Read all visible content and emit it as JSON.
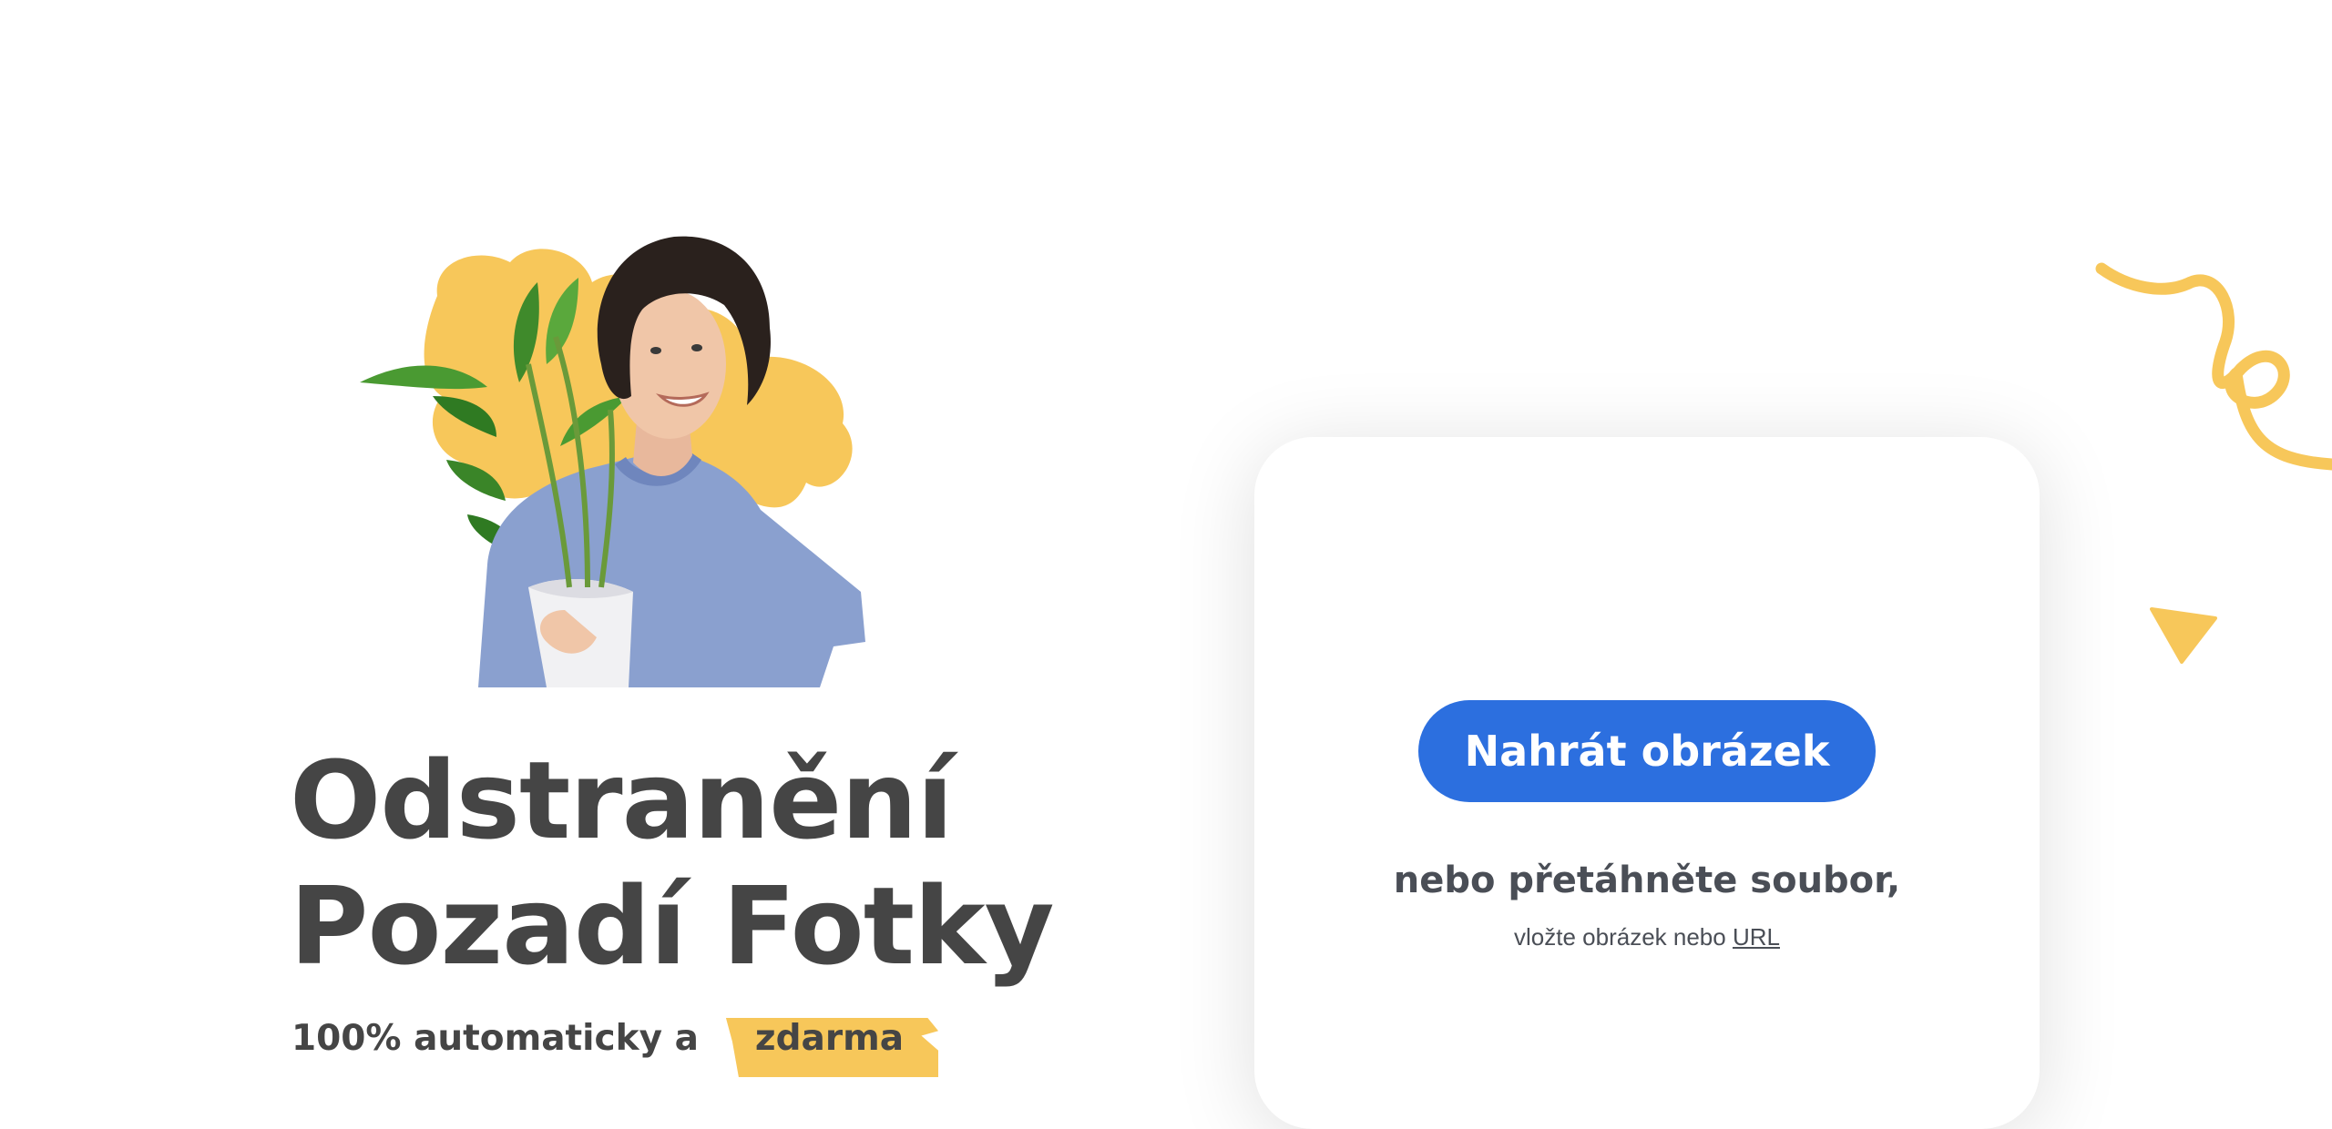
{
  "hero": {
    "title_line1": "Odstranění",
    "title_line2": "Pozadí Fotky",
    "subtitle_prefix": "100% automaticky a",
    "subtitle_highlight": "zdarma"
  },
  "upload": {
    "button_label": "Nahrát obrázek",
    "drop_text": "nebo přetáhněte soubor,",
    "paste_text": "vložte obrázek nebo",
    "url_link": "URL"
  },
  "colors": {
    "accent_yellow": "#f7c75a",
    "primary_blue": "#2c6fdf",
    "heading_text": "#454545"
  },
  "icons": {
    "decoration_1": "squiggle-line",
    "decoration_2": "triangle"
  }
}
